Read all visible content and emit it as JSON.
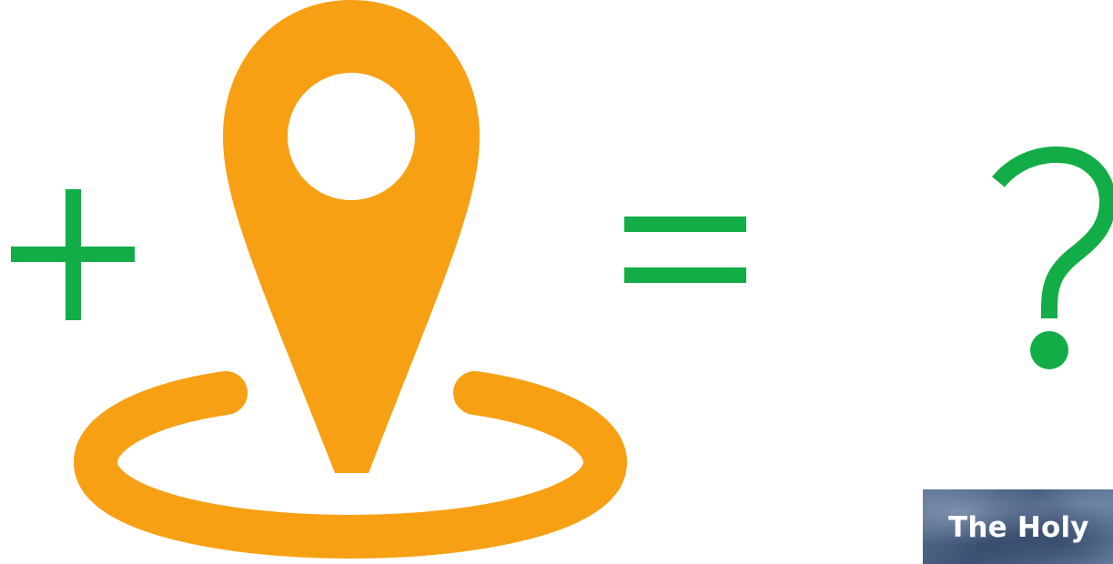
{
  "colors": {
    "operator_green": "#13ad48",
    "pin_orange": "#f7a014",
    "background": "#ffffff"
  },
  "equation": {
    "plus_symbol": "+",
    "icon": "location-pin-icon",
    "equals_symbol": "=",
    "unknown_symbol": "?"
  },
  "thumbnail": {
    "title": "The Holy"
  }
}
